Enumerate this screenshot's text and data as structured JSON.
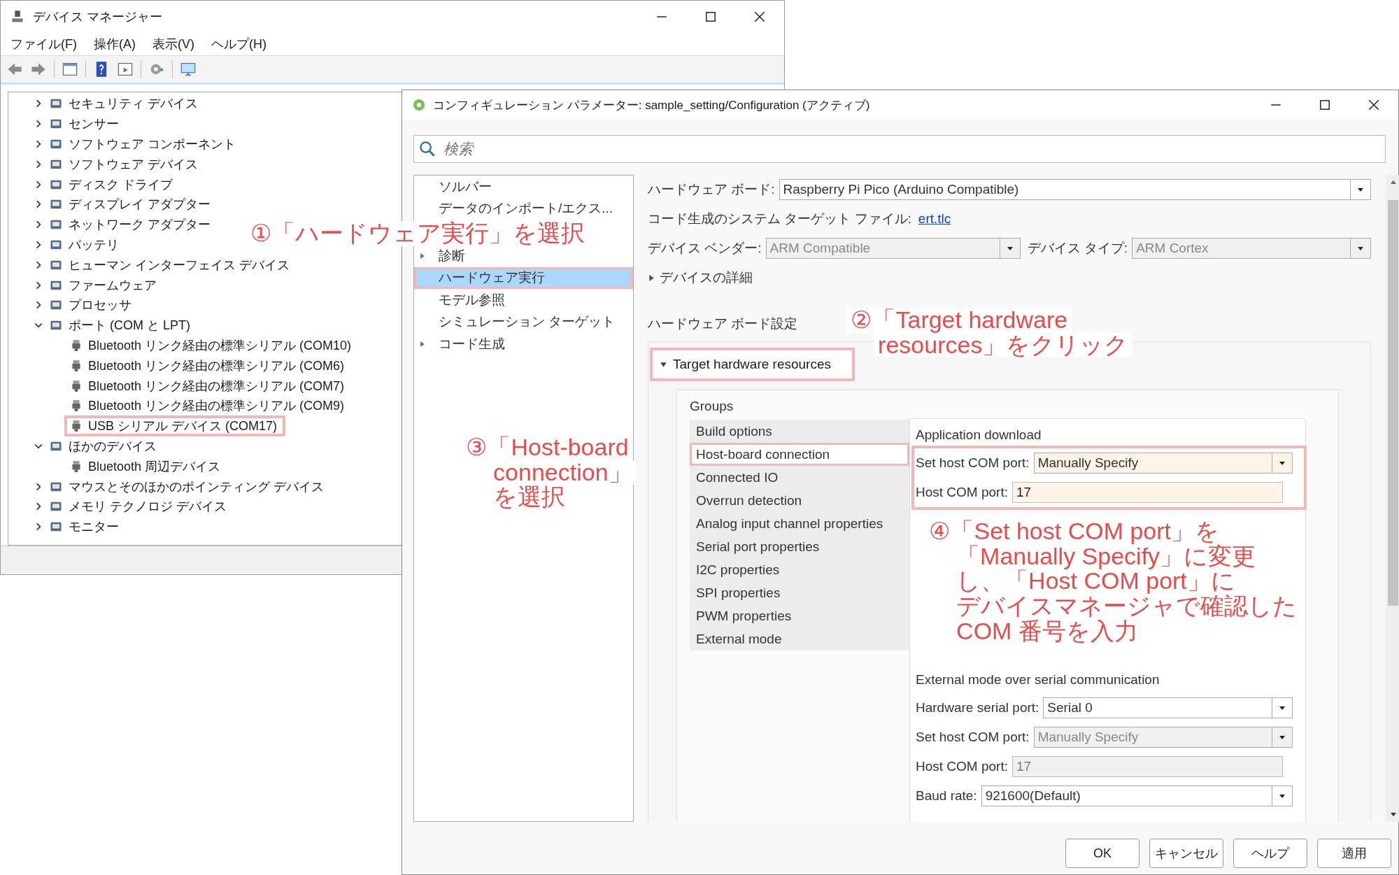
{
  "device_manager": {
    "title": "デバイス マネージャー",
    "menu": [
      "ファイル(F)",
      "操作(A)",
      "表示(V)",
      "ヘルプ(H)"
    ],
    "tree": [
      {
        "label": "セキュリティ デバイス",
        "expanded": false
      },
      {
        "label": "センサー",
        "expanded": false
      },
      {
        "label": "ソフトウェア コンポーネント",
        "expanded": false
      },
      {
        "label": "ソフトウェア デバイス",
        "expanded": false
      },
      {
        "label": "ディスク ドライブ",
        "expanded": false
      },
      {
        "label": "ディスプレイ アダプター",
        "expanded": false
      },
      {
        "label": "ネットワーク アダプター",
        "expanded": false
      },
      {
        "label": "バッテリ",
        "expanded": false
      },
      {
        "label": "ヒューマン インターフェイス デバイス",
        "expanded": false
      },
      {
        "label": "ファームウェア",
        "expanded": false
      },
      {
        "label": "プロセッサ",
        "expanded": false
      },
      {
        "label": "ポート (COM と LPT)",
        "expanded": true,
        "children": [
          {
            "label": "Bluetooth リンク経由の標準シリアル (COM10)",
            "highlighted": false
          },
          {
            "label": "Bluetooth リンク経由の標準シリアル (COM6)",
            "highlighted": false
          },
          {
            "label": "Bluetooth リンク経由の標準シリアル (COM7)",
            "highlighted": false
          },
          {
            "label": "Bluetooth リンク経由の標準シリアル (COM9)",
            "highlighted": false
          },
          {
            "label": "USB シリアル デバイス (COM17)",
            "highlighted": true
          }
        ]
      },
      {
        "label": "ほかのデバイス",
        "expanded": true,
        "children": [
          {
            "label": "Bluetooth 周辺デバイス",
            "highlighted": false
          }
        ]
      },
      {
        "label": "マウスとそのほかのポインティング デバイス",
        "expanded": false
      },
      {
        "label": "メモリ テクノロジ デバイス",
        "expanded": false
      },
      {
        "label": "モニター",
        "expanded": false
      }
    ]
  },
  "config_dialog": {
    "title": "コンフィギュレーション パラメーター: sample_setting/Configuration (アクティブ)",
    "search": {
      "placeholder": "検索"
    },
    "nav": [
      {
        "label": "ソルバー",
        "kind": "page",
        "selected": false,
        "highlighted": false
      },
      {
        "label": "データのインポート/エクス...",
        "kind": "page",
        "selected": false,
        "highlighted": false
      },
      {
        "label": "診断",
        "kind": "folder",
        "selected": false,
        "highlighted": false
      },
      {
        "label": "ハードウェア実行",
        "kind": "page",
        "selected": true,
        "highlighted": true
      },
      {
        "label": "モデル参照",
        "kind": "page",
        "selected": false,
        "highlighted": false
      },
      {
        "label": "シミュレーション ターゲット",
        "kind": "page",
        "selected": false,
        "highlighted": false
      },
      {
        "label": "コード生成",
        "kind": "folder",
        "selected": false,
        "highlighted": false
      }
    ],
    "hardware_board": {
      "label": "ハードウェア ボード:",
      "value": "Raspberry Pi Pico (Arduino Compatible)"
    },
    "code_generation": {
      "label": "コード生成のシステム ターゲット ファイル:",
      "link": "ert.tlc"
    },
    "device_vendor": {
      "label": "デバイス ベンダー:",
      "value": "ARM Compatible",
      "disabled": true
    },
    "device_type": {
      "label": "デバイス タイプ:",
      "value": "ARM Cortex",
      "disabled": true
    },
    "device_details": {
      "label": "デバイスの詳細",
      "expanded": false
    },
    "board_settings_label": "ハードウェア ボード設定",
    "target_resources": {
      "label": "Target hardware resources",
      "expanded": true,
      "highlighted": true
    },
    "groups_label": "Groups",
    "groups": [
      {
        "label": "Build options",
        "selected": false,
        "highlighted": false
      },
      {
        "label": "Host-board connection",
        "selected": true,
        "highlighted": true
      },
      {
        "label": "Connected IO",
        "selected": false,
        "highlighted": false
      },
      {
        "label": "Overrun detection",
        "selected": false,
        "highlighted": false
      },
      {
        "label": "Analog input channel properties",
        "selected": false,
        "highlighted": false
      },
      {
        "label": "Serial port properties",
        "selected": false,
        "highlighted": false
      },
      {
        "label": "I2C properties",
        "selected": false,
        "highlighted": false
      },
      {
        "label": "SPI properties",
        "selected": false,
        "highlighted": false
      },
      {
        "label": "PWM properties",
        "selected": false,
        "highlighted": false
      },
      {
        "label": "External mode",
        "selected": false,
        "highlighted": false
      }
    ],
    "sections": [
      {
        "title": "Application download",
        "highlighted": true,
        "fields": [
          {
            "label": "Set host COM port:",
            "kind": "dropdown",
            "value": "Manually Specify",
            "disabled": false,
            "modified": true
          },
          {
            "label": "Host COM port:",
            "kind": "text",
            "value": "17",
            "disabled": false,
            "modified": true
          }
        ]
      },
      {
        "title": "External mode over serial communication",
        "highlighted": false,
        "fields": [
          {
            "label": "Hardware serial port:",
            "kind": "dropdown",
            "value": "Serial 0",
            "disabled": false,
            "modified": false
          },
          {
            "label": "Set host COM port:",
            "kind": "dropdown",
            "value": "Manually Specify",
            "disabled": true,
            "modified": false
          },
          {
            "label": "Host COM port:",
            "kind": "text",
            "value": "17",
            "disabled": true,
            "modified": false
          },
          {
            "label": "Baud rate:",
            "kind": "dropdown",
            "value": "921600(Default)",
            "disabled": false,
            "modified": false
          }
        ]
      }
    ],
    "buttons": [
      "OK",
      "キャンセル",
      "ヘルプ",
      "適用"
    ]
  },
  "annotations": [
    {
      "lines": [
        "①「ハードウェア実行」を選択"
      ]
    },
    {
      "lines": [
        "②「Target hardware",
        "resources」をクリック"
      ]
    },
    {
      "lines": [
        "③「Host-board",
        "connection」",
        "を選択"
      ]
    },
    {
      "lines": [
        "④「Set host COM port」を",
        "「Manually Specify」に変更",
        "し、「Host COM port」に",
        "デバイスマネージャで確認した",
        "COM 番号を入力"
      ]
    }
  ]
}
